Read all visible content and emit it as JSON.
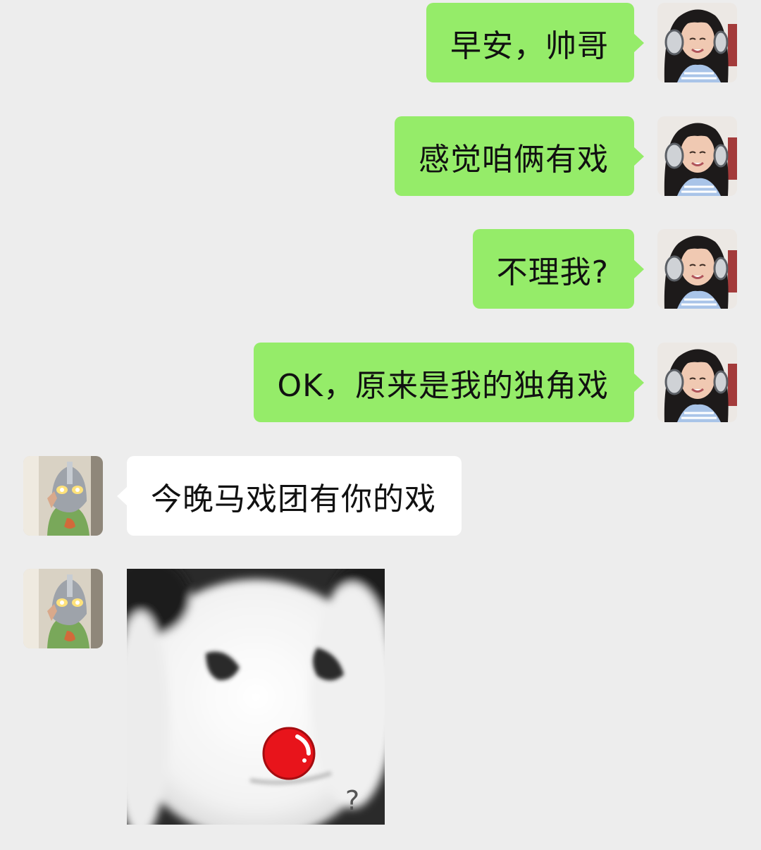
{
  "messages": [
    {
      "sender": "self",
      "text": "早安，帅哥"
    },
    {
      "sender": "self",
      "text": "感觉咱俩有戏"
    },
    {
      "sender": "self",
      "text": "不理我?"
    },
    {
      "sender": "self",
      "text": "OK，原来是我的独角戏"
    },
    {
      "sender": "other",
      "text": "今晚马戏团有你的戏"
    },
    {
      "sender": "other",
      "type": "sticker",
      "sticker_text": "?"
    }
  ],
  "colors": {
    "background": "#ededed",
    "self_bubble": "#95ec69",
    "other_bubble": "#ffffff",
    "sticker_nose": "#e8141b"
  }
}
